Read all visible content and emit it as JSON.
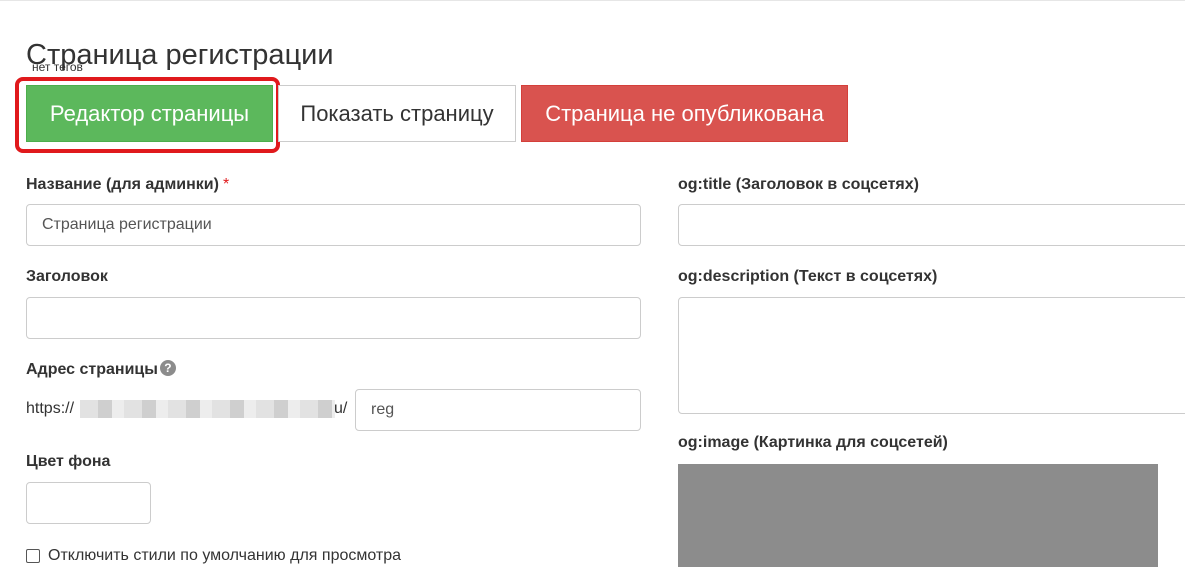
{
  "page": {
    "title": "Страница регистрации",
    "tags_text": "нет тегов"
  },
  "toolbar": {
    "editor_label": "Редактор страницы",
    "show_label": "Показать страницу",
    "status_label": "Страница не опубликована"
  },
  "form": {
    "name": {
      "label": "Название (для админки)",
      "required_mark": "*",
      "value": "Страница регистрации"
    },
    "heading": {
      "label": "Заголовок",
      "value": ""
    },
    "address": {
      "label": "Адрес страницы",
      "help_glyph": "?",
      "prefix": "https://",
      "suffix": "u/",
      "slug_value": "reg"
    },
    "bg_color": {
      "label": "Цвет фона",
      "value": ""
    },
    "disable_styles": {
      "label": "Отключить стили по умолчанию для просмотра",
      "checked": false
    },
    "og_title": {
      "label": "og:title (Заголовок в соцсетях)",
      "value": ""
    },
    "og_description": {
      "label": "og:description (Текст в соцсетях)",
      "value": ""
    },
    "og_image": {
      "label": "og:image (Картинка для соцсетей)"
    }
  },
  "colors": {
    "editor_button": "#5cb85c",
    "status_button": "#d9534f",
    "highlight": "#e0191c",
    "image_placeholder": "#8c8c8c"
  },
  "icons": {
    "help": "question-circle-icon"
  }
}
